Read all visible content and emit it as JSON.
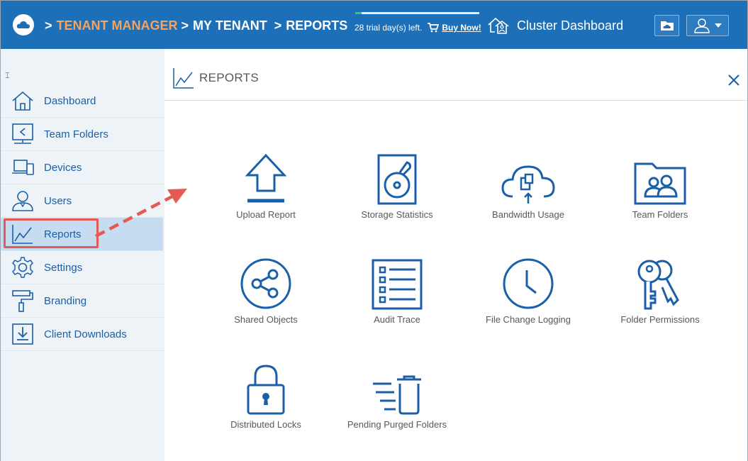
{
  "header": {
    "crumb_sep": ">",
    "crumb_tenant_manager": "TENANT MANAGER",
    "crumb_my_tenant": "MY TENANT",
    "crumb_reports": "REPORTS",
    "trial_text": "28 trial day(s) left.",
    "trial_progress": 0.05,
    "buy_now": "Buy Now!",
    "cluster_dashboard": "Cluster Dashboard"
  },
  "sidebar": {
    "items": [
      {
        "label": "Dashboard",
        "icon": "home-icon"
      },
      {
        "label": "Team Folders",
        "icon": "share-folder-icon"
      },
      {
        "label": "Devices",
        "icon": "devices-icon"
      },
      {
        "label": "Users",
        "icon": "user-icon"
      },
      {
        "label": "Reports",
        "icon": "chart-line-icon",
        "active": true
      },
      {
        "label": "Settings",
        "icon": "gear-icon"
      },
      {
        "label": "Branding",
        "icon": "paint-roller-icon"
      },
      {
        "label": "Client Downloads",
        "icon": "download-icon"
      }
    ]
  },
  "main": {
    "title": "REPORTS",
    "tiles": [
      {
        "label": "Upload Report",
        "icon": "upload-icon"
      },
      {
        "label": "Storage Statistics",
        "icon": "hard-drive-icon"
      },
      {
        "label": "Bandwidth Usage",
        "icon": "cloud-transfer-icon"
      },
      {
        "label": "Team Folders",
        "icon": "group-folder-icon"
      },
      {
        "label": "Shared Objects",
        "icon": "share-icon"
      },
      {
        "label": "Audit Trace",
        "icon": "checklist-icon"
      },
      {
        "label": "File Change Logging",
        "icon": "clock-icon"
      },
      {
        "label": "Folder Permissions",
        "icon": "keys-icon"
      },
      {
        "label": "Distributed Locks",
        "icon": "lock-icon"
      },
      {
        "label": "Pending Purged Folders",
        "icon": "trash-icon"
      }
    ]
  },
  "colors": {
    "brand": "#1d6fb8",
    "accent_orange": "#f5a35d",
    "icon_blue": "#1b5fa8",
    "annotation_red": "#e55a55"
  }
}
